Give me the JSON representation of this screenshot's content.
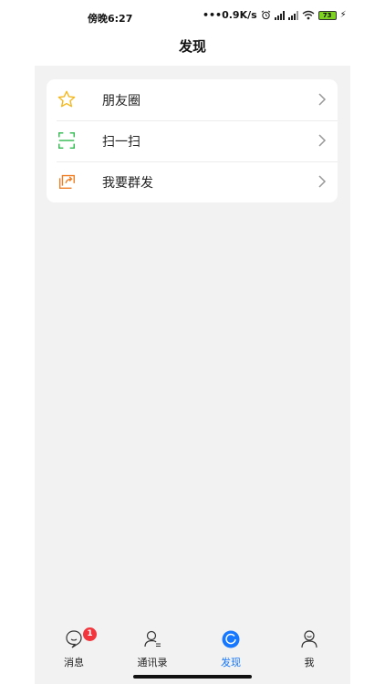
{
  "status_bar": {
    "time": "傍晚6:27",
    "speed": "0.9K/s",
    "battery_level": "73",
    "icons": [
      "alarm-icon",
      "signal-hd-icon",
      "signal-hd-icon",
      "wifi-icon",
      "battery-icon",
      "charging-icon"
    ]
  },
  "header": {
    "title": "发现"
  },
  "discover_menu": {
    "items": [
      {
        "label": "朋友圈",
        "icon": "star-icon",
        "icon_color": "#f5b81c"
      },
      {
        "label": "扫一扫",
        "icon": "scan-icon",
        "icon_color": "#2db84d"
      },
      {
        "label": "我要群发",
        "icon": "share-icon",
        "icon_color": "#f07d22"
      }
    ]
  },
  "tab_bar": {
    "items": [
      {
        "label": "消息",
        "icon": "chat-bubble-icon",
        "badge": "1"
      },
      {
        "label": "通讯录",
        "icon": "contacts-icon"
      },
      {
        "label": "发现",
        "icon": "discover-icon",
        "active": true
      },
      {
        "label": "我",
        "icon": "profile-icon"
      }
    ],
    "active_color": "#1677ff",
    "badge_color": "#f2353c"
  },
  "colors": {
    "background": "#f2f2f2",
    "card": "#ffffff"
  }
}
